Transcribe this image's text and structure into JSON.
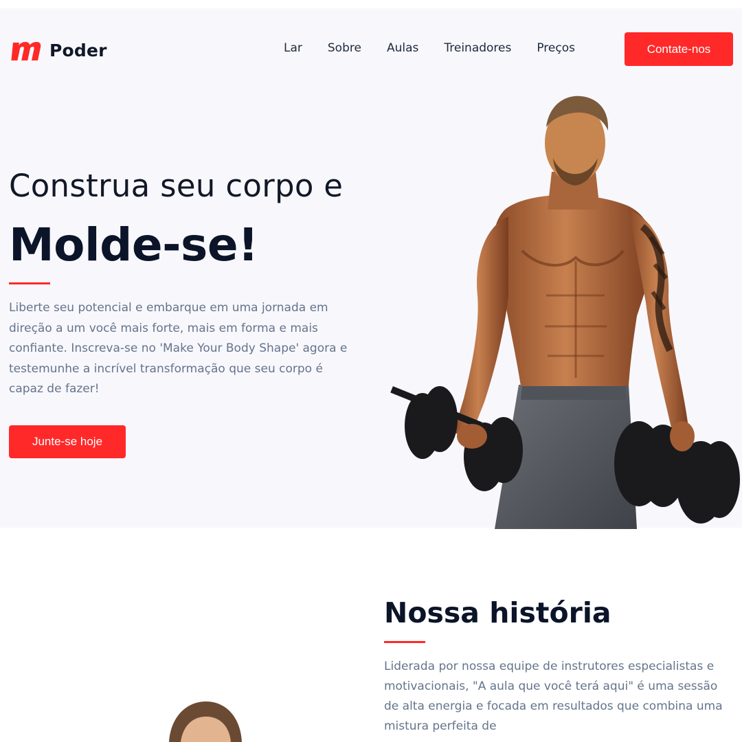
{
  "brand": {
    "name": "Poder",
    "logo_icon": "m-logo-icon",
    "accent_color": "#ff2929"
  },
  "nav": {
    "links": [
      "Lar",
      "Sobre",
      "Aulas",
      "Treinadores",
      "Preços"
    ],
    "cta_label": "Contate-nos"
  },
  "hero": {
    "subtitle": "Construa seu corpo e",
    "title": "Molde-se!",
    "description": "Liberte seu potencial e embarque em uma jornada em direção a um você mais forte, mais em forma e mais confiante. Inscreva-se no 'Make Your Body Shape' agora e testemunhe a incrível transformação que seu corpo é capaz de fazer!",
    "cta_label": "Junte-se hoje",
    "image_icon": "muscular-man-with-dumbbells-image"
  },
  "story": {
    "title": "Nossa história",
    "description": "Liderada por nossa equipe de instrutores especialistas e motivacionais, \"A aula que você terá aqui\" é uma sessão de alta energia e focada em resultados que combina uma mistura perfeita de",
    "image_icon": "trainer-portrait-image"
  }
}
